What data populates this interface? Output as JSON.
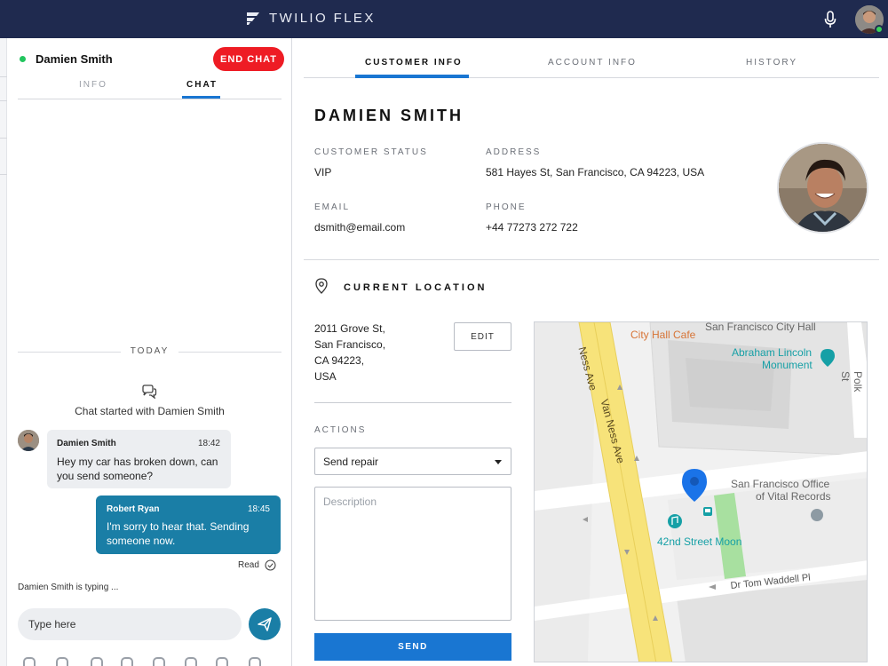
{
  "app": {
    "brand": "TWILIO FLEX"
  },
  "chat": {
    "customer_name": "Damien Smith",
    "end_chat_label": "END CHAT",
    "tabs": {
      "info": "INFO",
      "chat": "CHAT"
    },
    "day_divider": "TODAY",
    "started_text": "Chat started with Damien Smith",
    "messages": [
      {
        "author": "Damien Smith",
        "time": "18:42",
        "text": "Hey my car has broken down, can you send someone?"
      },
      {
        "author": "Robert Ryan",
        "time": "18:45",
        "text": "I'm sorry to hear that. Sending someone now."
      }
    ],
    "read_label": "Read",
    "typing_text": "Damien Smith is typing ...",
    "input_placeholder": "Type here"
  },
  "customer": {
    "tabs": [
      "CUSTOMER INFO",
      "ACCOUNT INFO",
      "HISTORY"
    ],
    "name": "DAMIEN SMITH",
    "status_label": "CUSTOMER STATUS",
    "status_value": "VIP",
    "address_label": "ADDRESS",
    "address_value": "581 Hayes St, San Francisco, CA 94223, USA",
    "email_label": "EMAIL",
    "email_value": "dsmith@email.com",
    "phone_label": "PHONE",
    "phone_value": "+44 77273 272 722"
  },
  "location": {
    "heading": "CURRENT LOCATION",
    "address_lines": [
      "2011 Grove St,",
      "San Francisco,",
      "CA 94223,",
      "USA"
    ],
    "edit_label": "EDIT",
    "actions_label": "ACTIONS",
    "action_selected": "Send repair",
    "description_placeholder": "Description",
    "send_label": "SEND"
  },
  "map": {
    "labels": {
      "city_hall_cafe": "City Hall Cafe",
      "sf_city_hall": "San Francisco City Hall",
      "lincoln_1": "Abraham Lincoln",
      "lincoln_2": "Monument",
      "van_ness_top": "Ness Ave",
      "van_ness": "Van Ness Ave",
      "polk": "Polk St",
      "vital_1": "San Francisco Office",
      "vital_2": "of Vital Records",
      "moon": "42nd Street Moon",
      "tom_waddell": "Dr Tom Waddell Pl"
    },
    "colors": {
      "road": "#f7e37a",
      "park": "#a8e0a0",
      "teal": "#16a0a6",
      "orange": "#d77436",
      "pin": "#1a73e8"
    }
  }
}
